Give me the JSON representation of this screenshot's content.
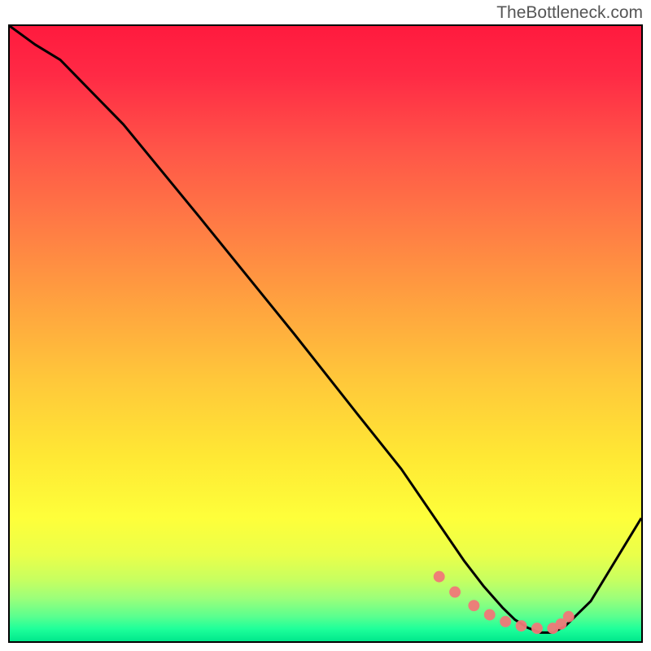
{
  "watermark": "TheBottleneck.com",
  "chart_data": {
    "type": "line",
    "title": "",
    "xlabel": "",
    "ylabel": "",
    "xlim": [
      0,
      100
    ],
    "ylim": [
      0,
      100
    ],
    "series": [
      {
        "name": "curve",
        "x": [
          0,
          4,
          8,
          18,
          30,
          45,
          55,
          62,
          68,
          72,
          75,
          78,
          80,
          82,
          84,
          86,
          88,
          92,
          100
        ],
        "y": [
          100,
          97,
          94.5,
          84,
          69,
          50,
          37,
          28,
          19,
          13,
          9,
          5.5,
          3.5,
          2.2,
          1.4,
          1.4,
          2.5,
          6.5,
          20
        ]
      }
    ],
    "markers": {
      "x": [
        68,
        70.5,
        73.5,
        76,
        78.5,
        81,
        83.5,
        86,
        87.3,
        88.5
      ],
      "y": [
        10.5,
        8,
        5.8,
        4.3,
        3.2,
        2.5,
        2.1,
        2.1,
        2.8,
        4
      ],
      "color": "#f07878",
      "size": 7
    },
    "gradient_stops": [
      {
        "pos": 0,
        "color": "#ff1a3e"
      },
      {
        "pos": 20,
        "color": "#ff5548"
      },
      {
        "pos": 45,
        "color": "#ffa23f"
      },
      {
        "pos": 70,
        "color": "#ffe834"
      },
      {
        "pos": 86,
        "color": "#eaff4a"
      },
      {
        "pos": 96,
        "color": "#5aff8f"
      },
      {
        "pos": 100,
        "color": "#00e88c"
      }
    ]
  }
}
